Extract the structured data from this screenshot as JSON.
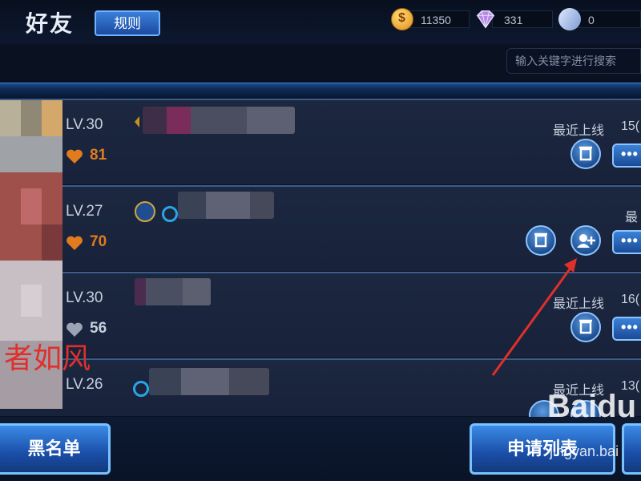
{
  "header": {
    "title": "好友",
    "rule_button": "规则"
  },
  "currencies": {
    "coins": "11350",
    "diamonds": "331",
    "vouchers": "0"
  },
  "search": {
    "placeholder": "输入关键字进行搜索"
  },
  "friends": [
    {
      "level": "LV.30",
      "intimacy": "81",
      "recent_label": "最近上线",
      "recent_value": "15("
    },
    {
      "level": "LV.27",
      "intimacy": "70",
      "recent_label": "最",
      "recent_value": ""
    },
    {
      "level": "LV.30",
      "intimacy": "56",
      "recent_label": "最近上线",
      "recent_value": "16("
    },
    {
      "level": "LV.26",
      "intimacy": "",
      "recent_label": "最近上线",
      "recent_value": "13("
    }
  ],
  "buttons": {
    "more": "•••",
    "blacklist": "黑名单",
    "apply_list": "申请列表"
  },
  "overlay": {
    "watermark_text": "者如风",
    "baidu_logo": "Baidu",
    "jingyan_url": "jingyan.bai"
  },
  "colors": {
    "accent_blue": "#3a82d8",
    "intimacy_orange": "#e07b1e",
    "arrow_red": "#e0302a"
  },
  "icons": [
    "coin-icon",
    "diamond-icon",
    "voucher-icon",
    "trash-icon",
    "add-friend-icon",
    "more-dots-icon",
    "heart-icon"
  ]
}
